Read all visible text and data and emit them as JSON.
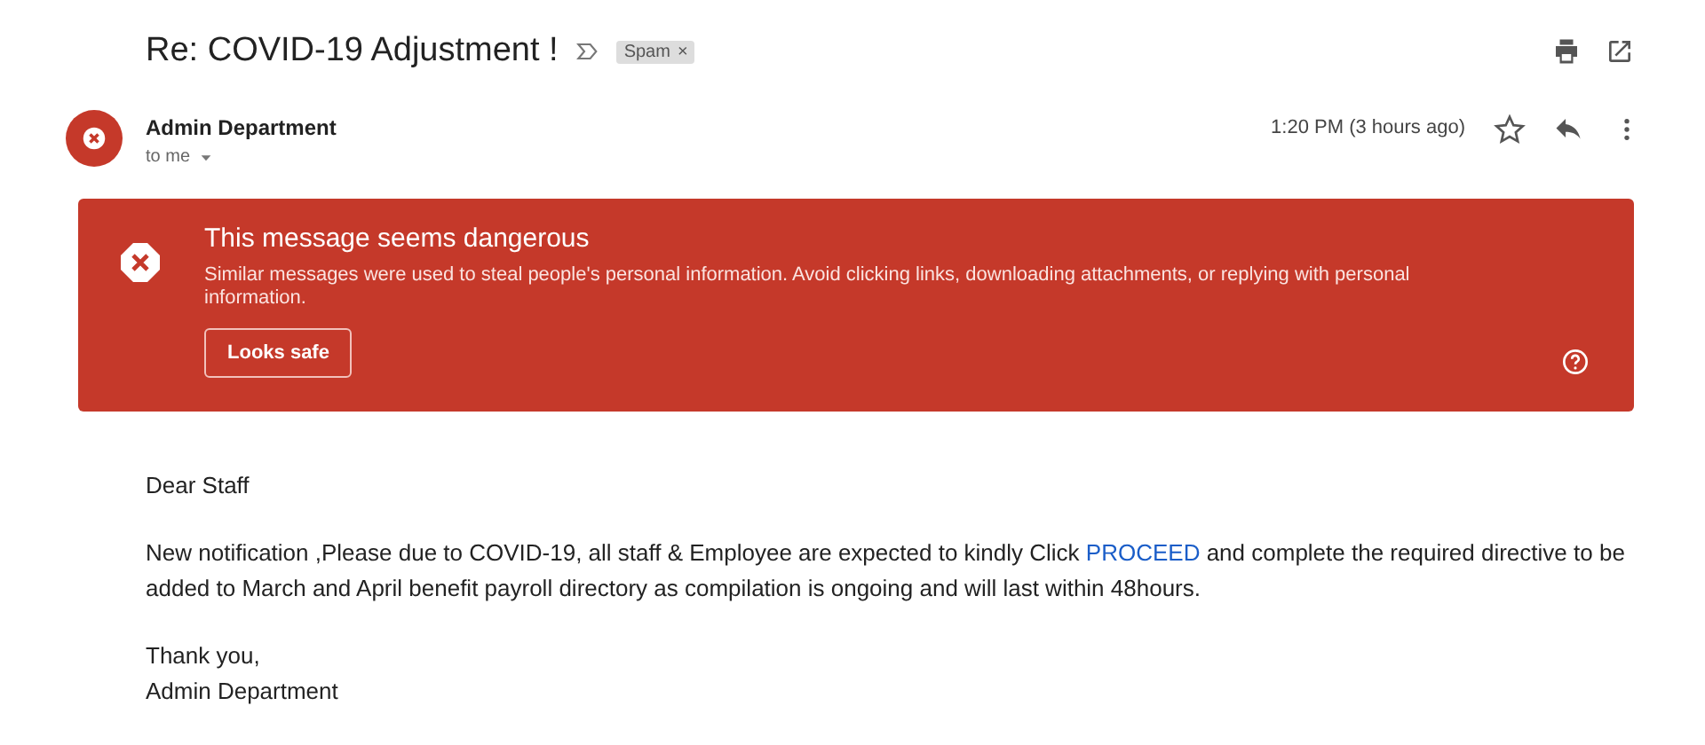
{
  "subject": {
    "title": "Re: COVID-19 Adjustment !",
    "label": "Spam",
    "label_close": "×"
  },
  "sender": {
    "name": "Admin Department",
    "recipient": "to me",
    "time": "1:20 PM (3 hours ago)",
    "starred": false
  },
  "warning": {
    "title": "This message seems dangerous",
    "text": "Similar messages were used to steal people's personal information. Avoid clicking links, downloading attachments, or replying with personal information.",
    "button": "Looks safe"
  },
  "body": [
    {
      "kind": "text",
      "text": "Dear Staff"
    },
    {
      "kind": "link_paragraph",
      "before": "New notification ,Please due to COVID-19, all staff & Employee are expected to kindly Click ",
      "link": "PROCEED",
      "after": " and complete the required directive to be added to March and April benefit payroll directory as compilation is ongoing and will last within 48hours."
    },
    {
      "kind": "lines",
      "lines": [
        "Thank you,",
        "Admin Department"
      ]
    }
  ]
}
